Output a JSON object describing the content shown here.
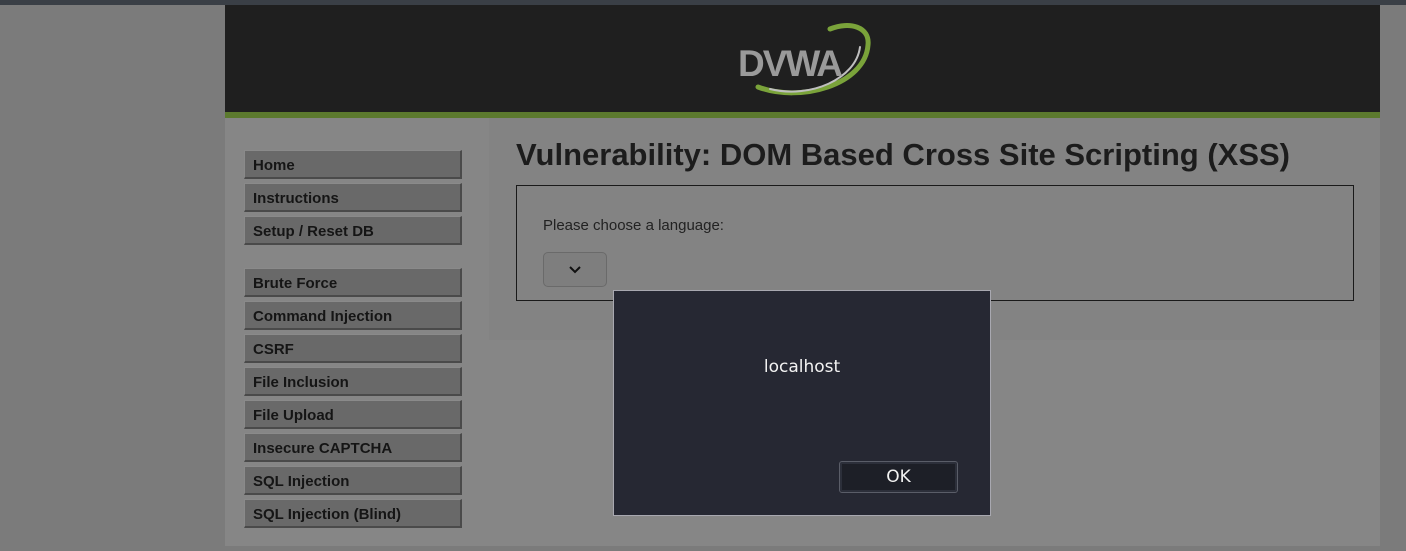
{
  "logo": {
    "text": "DVWA",
    "accent_color": "#7aa33a"
  },
  "sidebar": {
    "groups": [
      {
        "items": [
          {
            "label": "Home"
          },
          {
            "label": "Instructions"
          },
          {
            "label": "Setup / Reset DB"
          }
        ]
      },
      {
        "items": [
          {
            "label": "Brute Force"
          },
          {
            "label": "Command Injection"
          },
          {
            "label": "CSRF"
          },
          {
            "label": "File Inclusion"
          },
          {
            "label": "File Upload"
          },
          {
            "label": "Insecure CAPTCHA"
          },
          {
            "label": "SQL Injection"
          },
          {
            "label": "SQL Injection (Blind)"
          }
        ]
      }
    ]
  },
  "main": {
    "title": "Vulnerability: DOM Based Cross Site Scripting (XSS)",
    "language_label": "Please choose a language:",
    "language_select": {
      "selected": "",
      "icon": "chevron-down-icon"
    }
  },
  "dialog": {
    "message": "localhost",
    "ok_label": "OK"
  }
}
